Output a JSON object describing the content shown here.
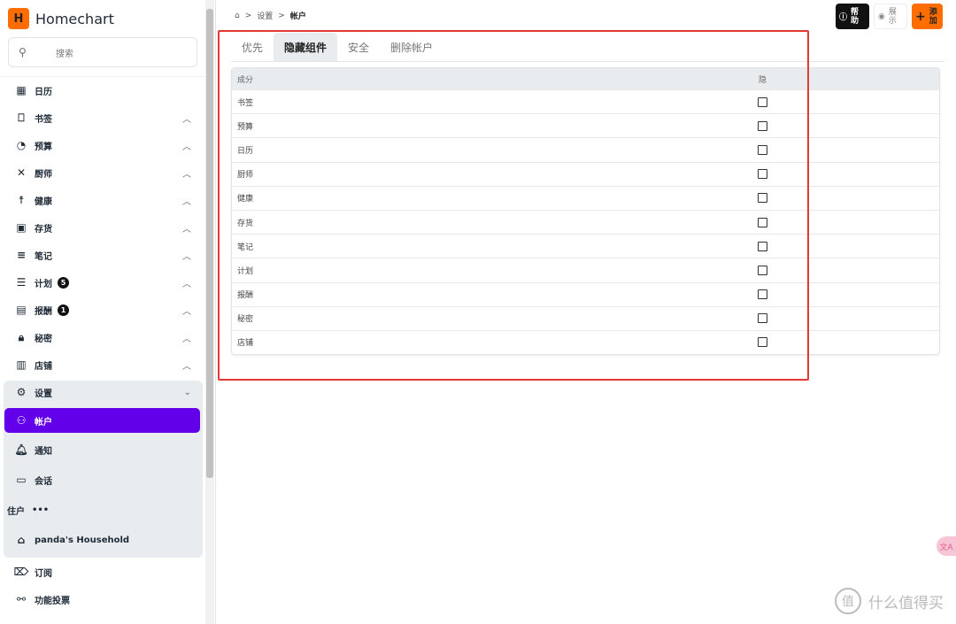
{
  "app": {
    "name": "Homechart",
    "logo_letter": "H"
  },
  "search": {
    "placeholder": "搜索"
  },
  "sidebar": {
    "items": [
      {
        "label": "日历",
        "icon": "calendar-icon"
      },
      {
        "label": "书签",
        "icon": "bookmark-icon"
      },
      {
        "label": "预算",
        "icon": "piggy-bank-icon"
      },
      {
        "label": "厨师",
        "icon": "utensils-icon"
      },
      {
        "label": "健康",
        "icon": "person-icon"
      },
      {
        "label": "存货",
        "icon": "inventory-icon"
      },
      {
        "label": "笔记",
        "icon": "notes-icon"
      },
      {
        "label": "计划",
        "icon": "checklist-icon",
        "badge": "5"
      },
      {
        "label": "报酬",
        "icon": "gift-icon",
        "badge": "1"
      },
      {
        "label": "秘密",
        "icon": "lock-icon"
      },
      {
        "label": "店铺",
        "icon": "store-icon"
      }
    ],
    "settings": {
      "label": "设置",
      "children": [
        {
          "label": "帐户"
        },
        {
          "label": "通知"
        },
        {
          "label": "会话"
        }
      ],
      "household_label": "住户",
      "household_more": "•••",
      "household": "panda's Household"
    },
    "bottom": [
      {
        "label": "订阅"
      },
      {
        "label": "功能投票"
      }
    ]
  },
  "breadcrumb": [
    "设置",
    "帐户"
  ],
  "topbar": {
    "help": [
      "帮",
      "助"
    ],
    "show": [
      "展",
      "示"
    ],
    "add": [
      "添",
      "加"
    ]
  },
  "tabs": [
    {
      "label": "优先"
    },
    {
      "label": "隐藏组件",
      "active": true
    },
    {
      "label": "安全"
    },
    {
      "label": "删除帐户"
    }
  ],
  "table": {
    "headers": [
      "成分",
      "隐"
    ],
    "rows": [
      "书签",
      "预算",
      "日历",
      "厨师",
      "健康",
      "存货",
      "笔记",
      "计划",
      "报酬",
      "秘密",
      "店铺"
    ]
  },
  "float_label": "文A",
  "watermark": "什么值得买",
  "watermark_logo": "值",
  "colors": {
    "accent": "#6200ea",
    "brand": "#ff6d00",
    "highlight": "#e53935"
  }
}
